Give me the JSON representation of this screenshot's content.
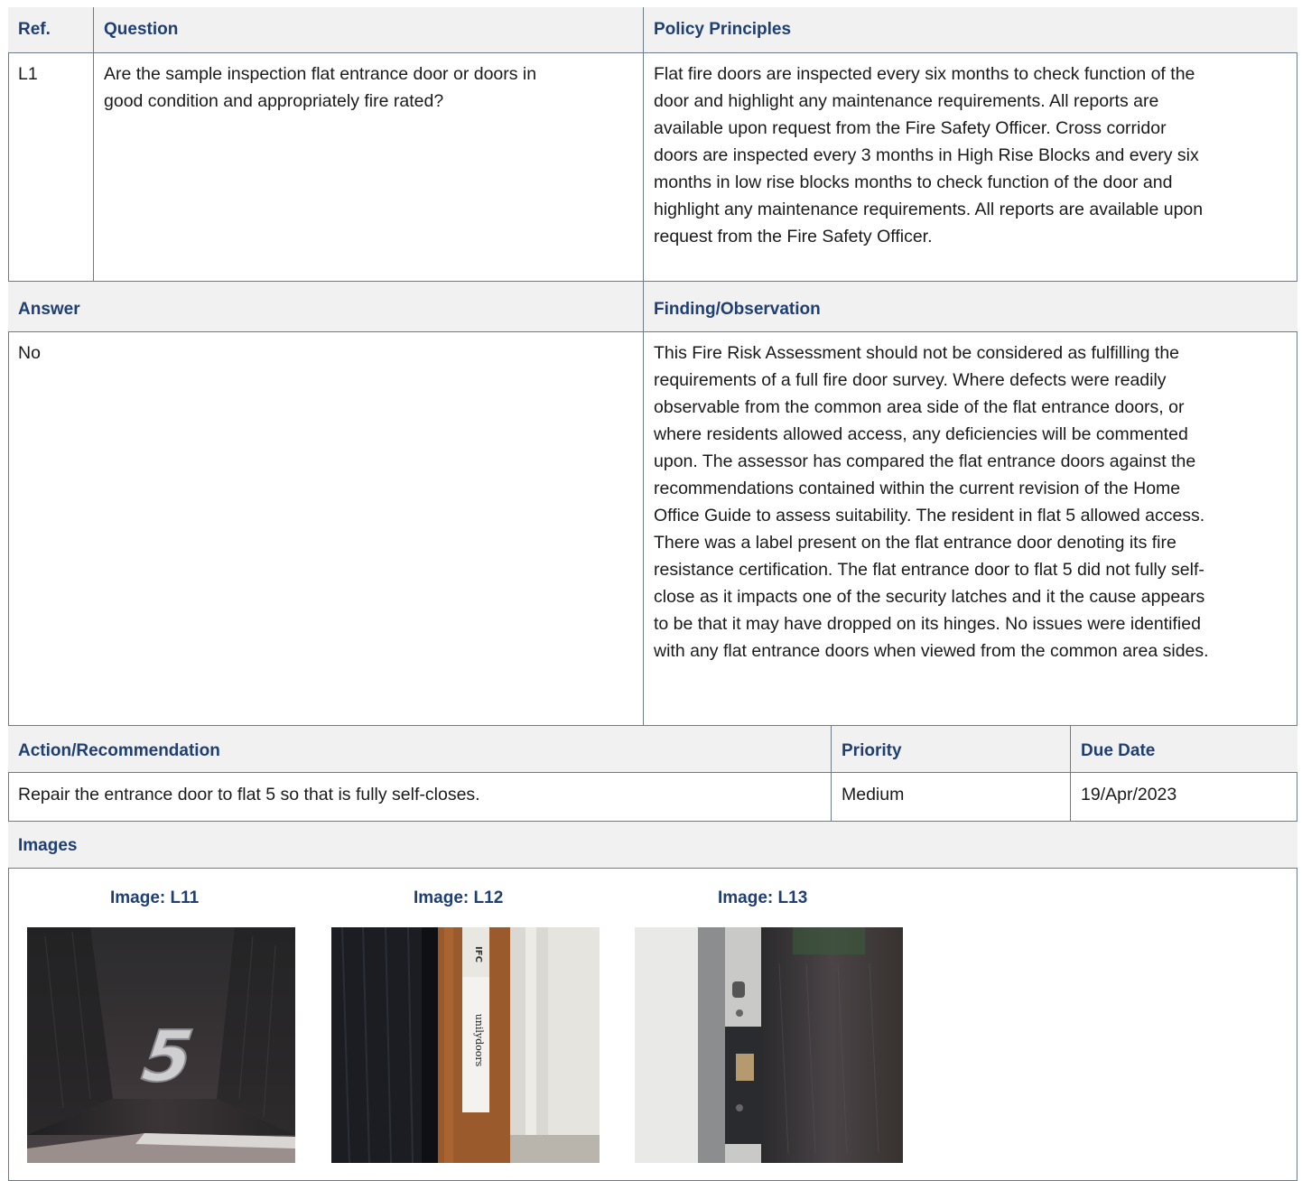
{
  "section1": {
    "headers": {
      "ref": "Ref.",
      "question": "Question",
      "policy": "Policy Principles"
    },
    "ref": "L1",
    "question": "Are the sample inspection flat entrance door or doors in good condition and appropriately fire rated?",
    "policy": "Flat fire doors are inspected every six months to check function of the door and highlight any maintenance requirements. All reports are available upon request from the Fire Safety Officer. Cross corridor doors are inspected every 3 months in High Rise Blocks and every six months in low rise blocks months to check function of the door and highlight any maintenance requirements. All reports are available upon request from the Fire Safety Officer."
  },
  "section2": {
    "headers": {
      "answer": "Answer",
      "finding": "Finding/Observation"
    },
    "answer": "No",
    "finding": "This Fire Risk Assessment should not be considered as fulfilling the requirements of a full fire door survey. Where defects were readily observable from the common area side of the flat entrance doors, or where residents allowed access, any deficiencies will be commented upon. The assessor has compared the flat entrance doors against the recommendations contained within the current revision of the Home Office Guide to assess suitability. The resident in flat 5 allowed access. There was a label present on the flat entrance door denoting its fire resistance certification. The flat entrance door to flat 5 did not fully self-close as it impacts one of the security latches and it the cause appears to be that it may have dropped on its hinges. No issues were identified with any flat entrance doors when viewed from the common area sides."
  },
  "section3": {
    "headers": {
      "action": "Action/Recommendation",
      "priority": "Priority",
      "due": "Due Date"
    },
    "action": "Repair the entrance door to flat 5 so that is fully self-closes.",
    "priority": "Medium",
    "due": "19/Apr/2023"
  },
  "images": {
    "header": "Images",
    "captions": [
      "Image: L11",
      "Image: L12",
      "Image: L13"
    ],
    "photo1_text": "5",
    "photo2_label_brand": "unilydoors",
    "photo2_label_logo": "IFC"
  },
  "colors": {
    "header_text": "#1f3f73",
    "header_bg": "#f1f1f1",
    "border": "#6d7b8a"
  }
}
